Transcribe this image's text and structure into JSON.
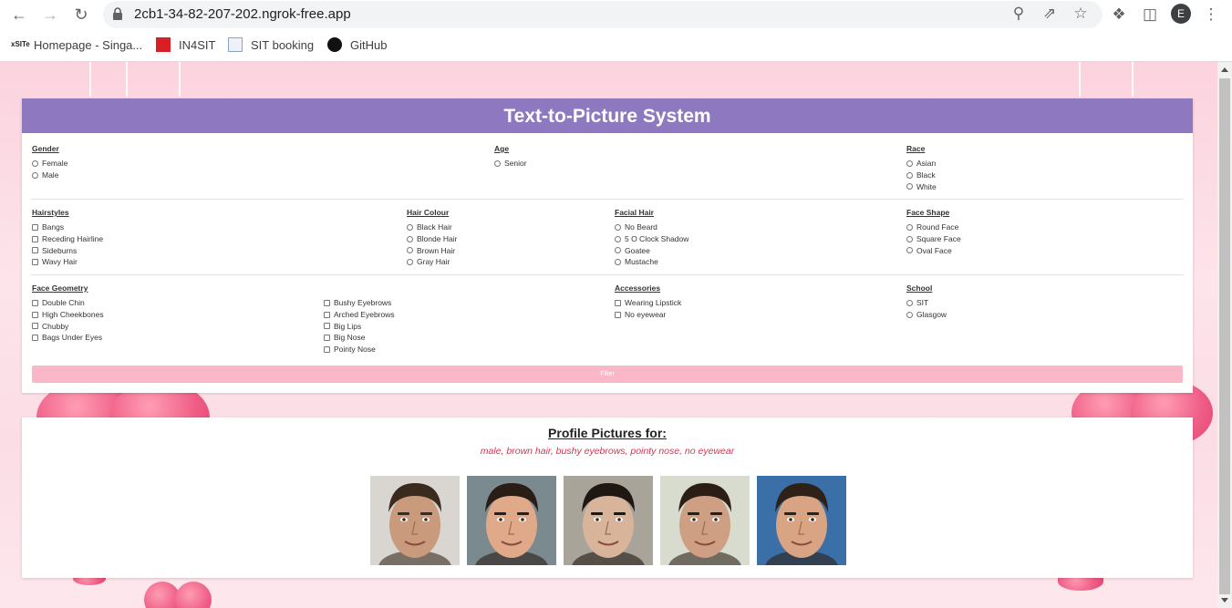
{
  "browser": {
    "url": "2cb1-34-82-207-202.ngrok-free.app",
    "avatar_letter": "E",
    "bookmarks": [
      {
        "label": "Homepage - Singa...",
        "icon": "sit-logo-icon"
      },
      {
        "label": "IN4SIT",
        "icon": "in4sit-icon"
      },
      {
        "label": "SIT booking",
        "icon": "booking-icon"
      },
      {
        "label": "GitHub",
        "icon": "github-icon"
      }
    ]
  },
  "form": {
    "title": "Text-to-Picture System",
    "groups": {
      "gender": {
        "title": "Gender",
        "type": "radio",
        "options": [
          "Female",
          "Male"
        ]
      },
      "age": {
        "title": "Age",
        "type": "radio",
        "options": [
          "Senior"
        ]
      },
      "race": {
        "title": "Race",
        "type": "radio",
        "options": [
          "Asian",
          "Black",
          "White"
        ]
      },
      "hairstyles": {
        "title": "Hairstyles",
        "type": "checkbox",
        "options": [
          "Bangs",
          "Receding Hairline",
          "Sideburns",
          "Wavy Hair"
        ]
      },
      "hair_colour": {
        "title": "Hair Colour",
        "type": "radio",
        "options": [
          "Black Hair",
          "Blonde Hair",
          "Brown Hair",
          "Gray Hair"
        ]
      },
      "facial_hair": {
        "title": "Facial Hair",
        "type": "radio",
        "options": [
          "No Beard",
          "5 O Clock Shadow",
          "Goatee",
          "Mustache"
        ]
      },
      "face_shape": {
        "title": "Face Shape",
        "type": "radio",
        "options": [
          "Round Face",
          "Square Face",
          "Oval Face"
        ]
      },
      "face_geometry": {
        "title": "Face Geometry",
        "type": "checkbox",
        "options": [
          "Double Chin",
          "High Cheekbones",
          "Chubby",
          "Bags Under Eyes"
        ]
      },
      "face_geometry_2": {
        "type": "checkbox",
        "options": [
          "Bushy Eyebrows",
          "Arched Eyebrows",
          "Big Lips",
          "Big Nose",
          "Pointy Nose"
        ]
      },
      "accessories": {
        "title": "Accessories",
        "type": "checkbox",
        "options": [
          "Wearing Lipstick",
          "No eyewear"
        ]
      },
      "school": {
        "title": "School",
        "type": "radio",
        "options": [
          "SIT",
          "Glasgow"
        ]
      }
    },
    "filter_label": "Filter"
  },
  "results": {
    "title": "Profile Pictures for:",
    "query": "male, brown hair, bushy eyebrows, pointy nose, no eyewear",
    "images": [
      {
        "name": "profile-picture-1",
        "skin": "#c99a7c",
        "hair": "#3b2a1e",
        "bg": "#d9d6d2"
      },
      {
        "name": "profile-picture-2",
        "skin": "#e0a98a",
        "hair": "#2a1d16",
        "bg": "#7b8a8e"
      },
      {
        "name": "profile-picture-3",
        "skin": "#d8b49a",
        "hair": "#1e1712",
        "bg": "#a9a49a"
      },
      {
        "name": "profile-picture-4",
        "skin": "#cf9f83",
        "hair": "#2b1e15",
        "bg": "#d7dccf"
      },
      {
        "name": "profile-picture-5",
        "skin": "#d8a483",
        "hair": "#2e2118",
        "bg": "#3b6fa8"
      }
    ]
  }
}
